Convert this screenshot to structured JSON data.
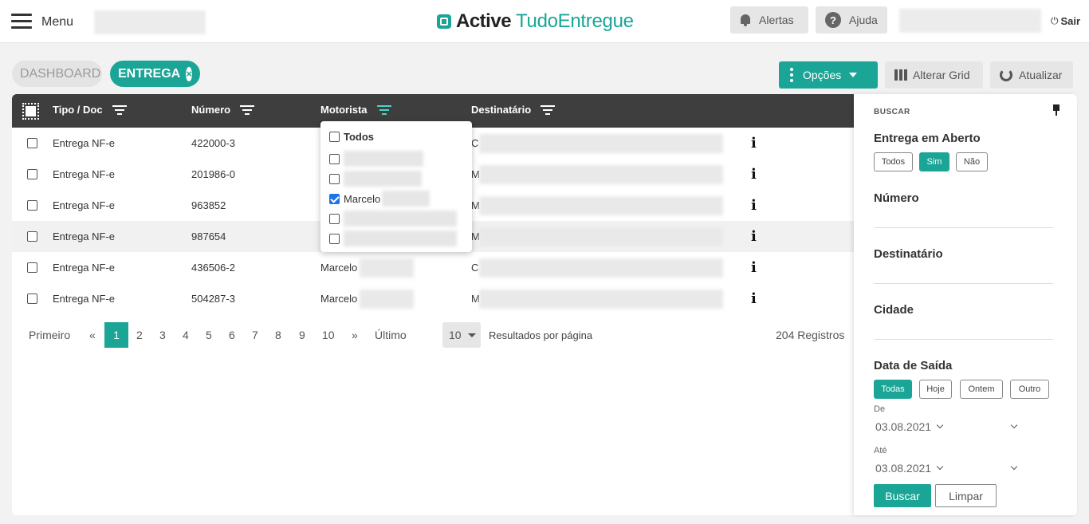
{
  "header": {
    "menu_label": "Menu",
    "brand_active": "Active",
    "brand_tudo": "TudoEntregue",
    "alertas_label": "Alertas",
    "ajuda_label": "Ajuda",
    "help_glyph": "?",
    "sair_label": "Sair",
    "sair_glyph": "⏻"
  },
  "tabs": {
    "dashboard": "DASHBOARD",
    "entrega": "ENTREGA",
    "close_glyph": "×"
  },
  "toolbar": {
    "opcoes": "Opções",
    "alterar_grid": "Alterar Grid",
    "atualizar": "Atualizar"
  },
  "table": {
    "columns": [
      "Tipo / Doc",
      "Número",
      "Motorista",
      "Destinatário"
    ],
    "info_glyph": "i",
    "rows": [
      {
        "tipo": "Entrega NF-e",
        "numero": "422000-3",
        "motorista": "",
        "dest_prefix": "C"
      },
      {
        "tipo": "Entrega NF-e",
        "numero": "201986-0",
        "motorista": "",
        "dest_prefix": "M"
      },
      {
        "tipo": "Entrega NF-e",
        "numero": "963852",
        "motorista": "",
        "dest_prefix": "M"
      },
      {
        "tipo": "Entrega NF-e",
        "numero": "987654",
        "motorista": "",
        "dest_prefix": "M"
      },
      {
        "tipo": "Entrega NF-e",
        "numero": "436506-2",
        "motorista": "Marcelo",
        "dest_prefix": "C"
      },
      {
        "tipo": "Entrega NF-e",
        "numero": "504287-3",
        "motorista": "Marcelo",
        "dest_prefix": "M"
      }
    ]
  },
  "motorista_filter": {
    "todos": "Todos",
    "selected": "Marcelo"
  },
  "pagination": {
    "first": "Primeiro",
    "prev": "«",
    "pages": [
      "1",
      "2",
      "3",
      "4",
      "5",
      "6",
      "7",
      "8",
      "9",
      "10"
    ],
    "next": "»",
    "last": "Último",
    "per_page": "10",
    "results_label": "Resultados por página",
    "total": "204 Registros"
  },
  "sidebar": {
    "buscar": "BUSCAR",
    "entrega_aberto": "Entrega em Aberto",
    "aberto_options": [
      "Todos",
      "Sim",
      "Não"
    ],
    "numero": "Número",
    "destinatario": "Destinatário",
    "cidade": "Cidade",
    "data_saida": "Data de Saída",
    "data_options": [
      "Todas",
      "Hoje",
      "Ontem",
      "Outro"
    ],
    "de_label": "De",
    "de_value": "03.08.2021",
    "ate_label": "Até",
    "ate_value": "03.08.2021",
    "buscar_btn": "Buscar",
    "limpar_btn": "Limpar"
  },
  "colors": {
    "accent": "#1aa596",
    "header_bg": "#3e3e3e",
    "checkbox_checked": "#1e73e8"
  }
}
